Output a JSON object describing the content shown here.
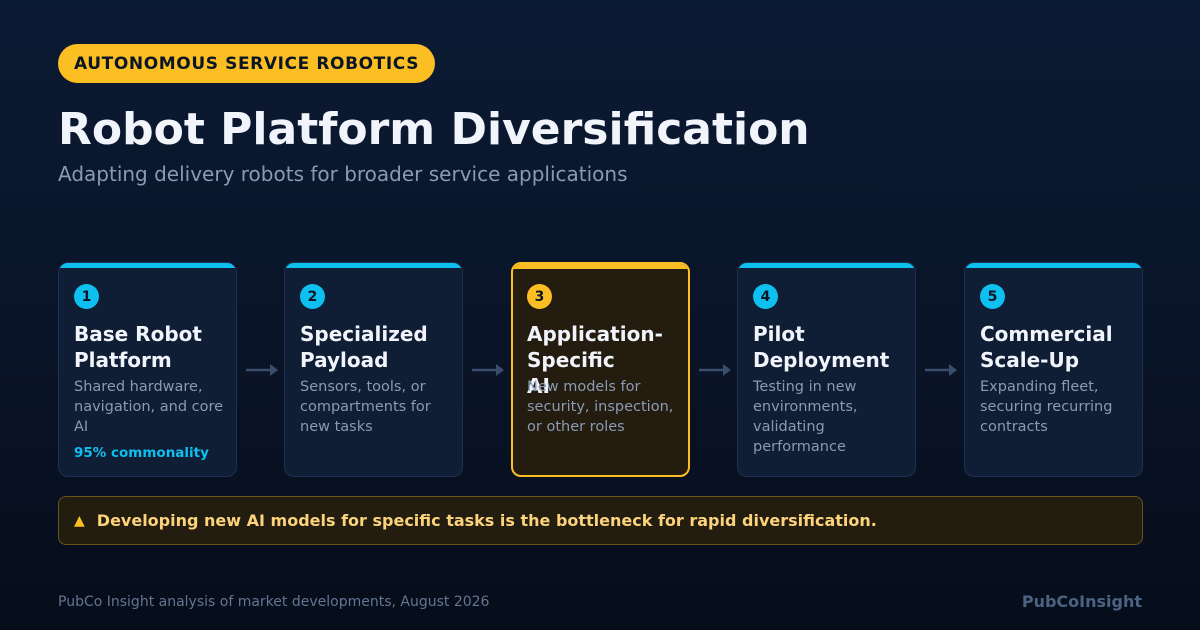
{
  "badge": "AUTONOMOUS SERVICE ROBOTICS",
  "title": "Robot Platform Diversification",
  "subtitle": "Adapting delivery robots for broader service applications",
  "steps": [
    {
      "number": "1",
      "title": "Base Robot\nPlatform",
      "description": "Shared hardware, navigation, and core AI",
      "note": "95% commonality"
    },
    {
      "number": "2",
      "title": "Specialized\nPayload",
      "description": "Sensors, tools, or compartments for new tasks"
    },
    {
      "number": "3",
      "title": "Application-Specific\nAI",
      "description": "New models for security, inspection, or other roles",
      "highlighted": true
    },
    {
      "number": "4",
      "title": "Pilot\nDeployment",
      "description": "Testing in new environments, validating performance"
    },
    {
      "number": "5",
      "title": "Commercial\nScale-Up",
      "description": "Expanding fleet, securing recurring contracts"
    }
  ],
  "callout": {
    "icon": "warning-icon",
    "text": "Developing new AI models for specific tasks is the bottleneck for rapid diversification."
  },
  "footer": {
    "source": "PubCo Insight analysis of market developments, August 2026",
    "brand": "PubCoInsight"
  },
  "colors": {
    "accent": "#0ec0f0",
    "highlight": "#fbbf24",
    "background": "#0a1428"
  }
}
